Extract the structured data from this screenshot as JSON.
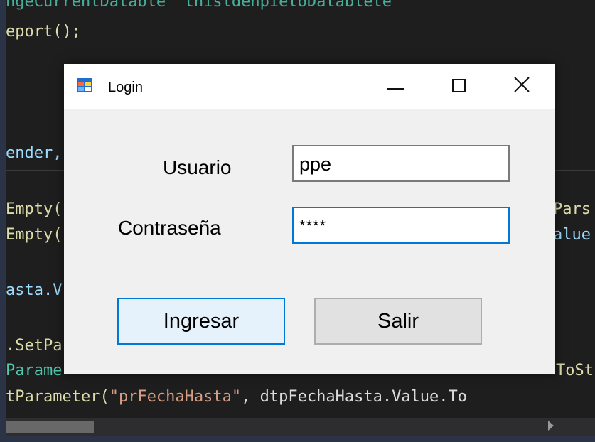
{
  "window": {
    "title": "Login",
    "controls": {
      "minimize": "minimize",
      "maximize": "maximize",
      "close": "close"
    }
  },
  "form": {
    "usuario_label": "Usuario",
    "usuario_value": "ppe",
    "contrasena_label": "Contraseña",
    "contrasena_value": "****",
    "ingresar_label": "Ingresar",
    "salir_label": "Salir"
  },
  "code": {
    "line1": "ngeCurrentDatable  thisldehpietoDatablete",
    "line2": "eport();",
    "line3": "ender,",
    "line4": "Empty(",
    "line4_right": "Pars",
    "line5": "Empty(",
    "line5_right": "alue",
    "line6": "asta.V",
    "line7": ".SetPa",
    "line8_left": "Parame",
    "line8_right": "ToSt",
    "line9_a": "tParameter(",
    "line9_b": "\"prFechaHasta\"",
    "line9_c": ", dtpFechaHasta.Value.To"
  },
  "colors": {
    "ide_bg": "#1e1e1e",
    "outer_bg": "#2b3446",
    "accent": "#0078d7",
    "method": "#dcdcaa",
    "string": "#d69d85",
    "type": "#4ec9b0",
    "keyword": "#9cdcfe"
  }
}
